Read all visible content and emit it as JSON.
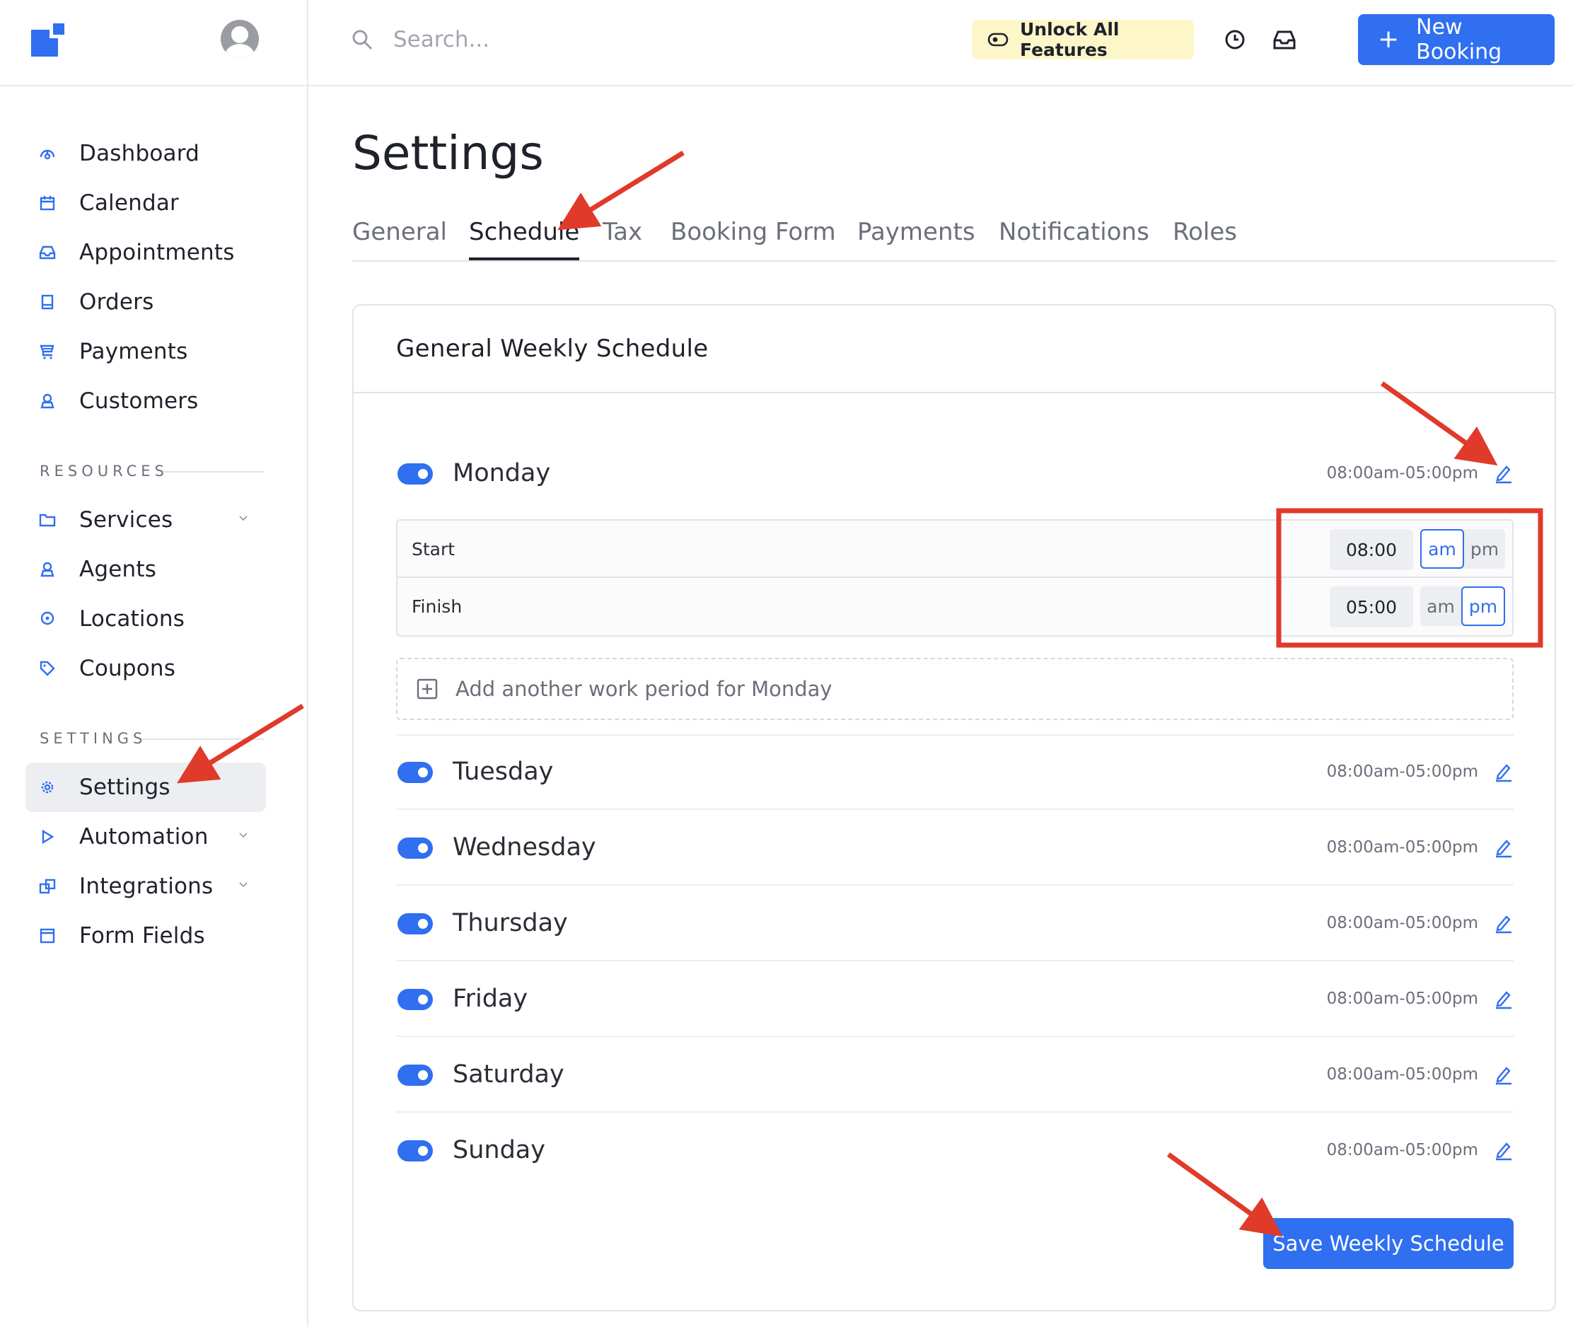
{
  "sidebar": {
    "main_items": [
      {
        "label": "Dashboard",
        "icon": "dashboard-icon"
      },
      {
        "label": "Calendar",
        "icon": "calendar-icon"
      },
      {
        "label": "Appointments",
        "icon": "inbox-icon"
      },
      {
        "label": "Orders",
        "icon": "book-icon"
      },
      {
        "label": "Payments",
        "icon": "cart-icon"
      },
      {
        "label": "Customers",
        "icon": "user-icon"
      }
    ],
    "resources_title": "RESOURCES",
    "resources_items": [
      {
        "label": "Services",
        "icon": "folder-icon"
      },
      {
        "label": "Agents",
        "icon": "user-icon"
      },
      {
        "label": "Locations",
        "icon": "pin-icon"
      },
      {
        "label": "Coupons",
        "icon": "tag-icon"
      }
    ],
    "settings_title": "SETTINGS",
    "settings_items": [
      {
        "label": "Settings",
        "icon": "gear-icon"
      },
      {
        "label": "Automation",
        "icon": "play-icon"
      },
      {
        "label": "Integrations",
        "icon": "windows-icon"
      },
      {
        "label": "Form Fields",
        "icon": "form-icon"
      }
    ]
  },
  "topbar": {
    "search_placeholder": "Search...",
    "unlock_label": "Unlock All Features",
    "new_booking_label": "New Booking"
  },
  "page": {
    "title": "Settings",
    "tabs": [
      "General",
      "Schedule",
      "Tax",
      "Booking Form",
      "Payments",
      "Notifications",
      "Roles"
    ],
    "active_tab": "Schedule"
  },
  "schedule": {
    "card_title": "General Weekly Schedule",
    "days": [
      {
        "name": "Monday",
        "time": "08:00am-05:00pm",
        "enabled": true
      },
      {
        "name": "Tuesday",
        "time": "08:00am-05:00pm",
        "enabled": true
      },
      {
        "name": "Wednesday",
        "time": "08:00am-05:00pm",
        "enabled": true
      },
      {
        "name": "Thursday",
        "time": "08:00am-05:00pm",
        "enabled": true
      },
      {
        "name": "Friday",
        "time": "08:00am-05:00pm",
        "enabled": true
      },
      {
        "name": "Saturday",
        "time": "08:00am-05:00pm",
        "enabled": true
      },
      {
        "name": "Sunday",
        "time": "08:00am-05:00pm",
        "enabled": true
      }
    ],
    "period": {
      "start_label": "Start",
      "start_value": "08:00",
      "start_ampm": "am",
      "finish_label": "Finish",
      "finish_value": "05:00",
      "finish_ampm": "pm",
      "am_label": "am",
      "pm_label": "pm"
    },
    "add_period_label": "Add another work period for Monday",
    "save_label": "Save Weekly Schedule"
  },
  "colors": {
    "accent": "#2f6ff0",
    "annotation": "#e03a2a",
    "unlock_bg": "#fdf6c8"
  }
}
